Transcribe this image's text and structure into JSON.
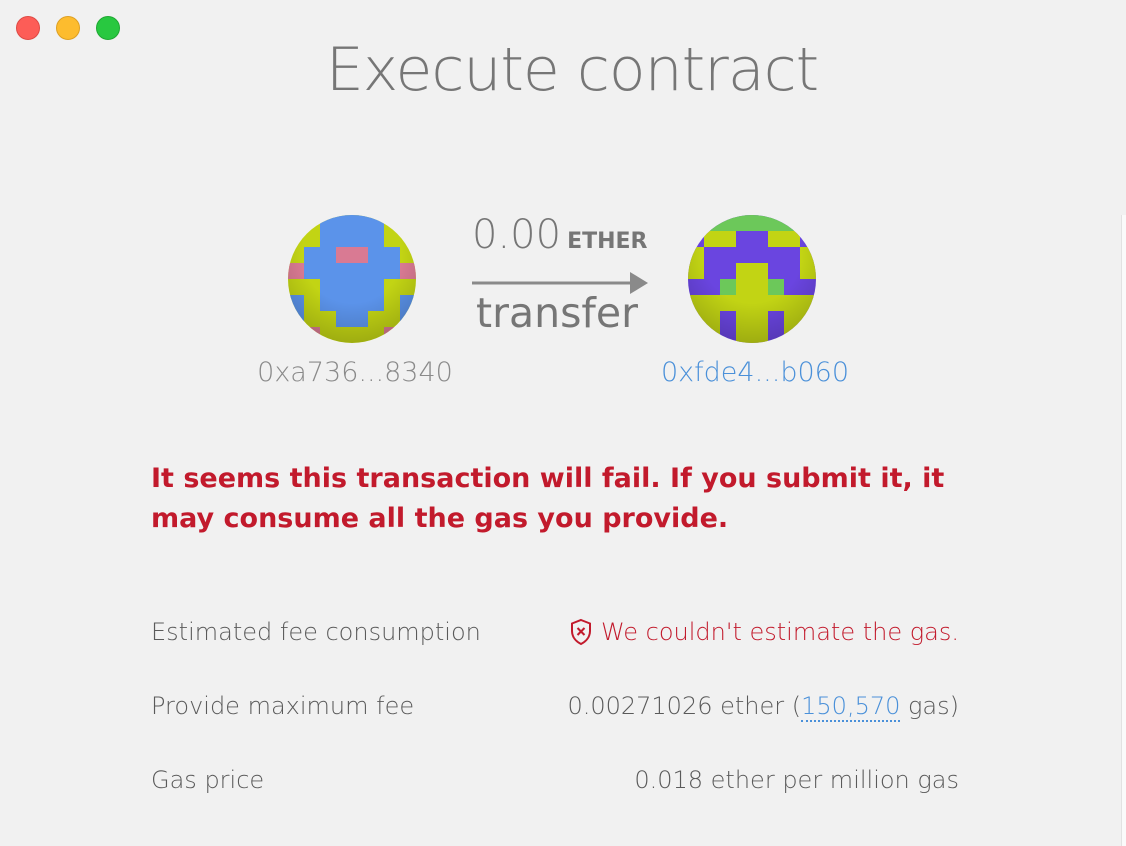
{
  "window": {
    "title": "Execute contract"
  },
  "transfer": {
    "from_address": "0xa736...8340",
    "to_address": "0xfde4...b060",
    "amount": "0.00",
    "unit": "ETHER",
    "method": "transfer",
    "from_identicon": "identicon-yellow-blue",
    "to_identicon": "identicon-purple-yellow"
  },
  "warning": {
    "message": "It seems this transaction will fail. If you submit it, it may consume all the gas you provide."
  },
  "fees": {
    "estimated_label": "Estimated fee consumption",
    "estimated_value": "We couldn't estimate the gas.",
    "max_label": "Provide maximum fee",
    "max_value_prefix": "0.00271026 ether (",
    "max_gas": "150,570",
    "max_value_suffix": " gas)",
    "price_label": "Gas price",
    "price_value": "0.018 ether per million gas",
    "error_icon": "shield-x-icon"
  },
  "colors": {
    "error": "#c21a2c",
    "link": "#4a90d9",
    "background": "#f1f1f1"
  }
}
